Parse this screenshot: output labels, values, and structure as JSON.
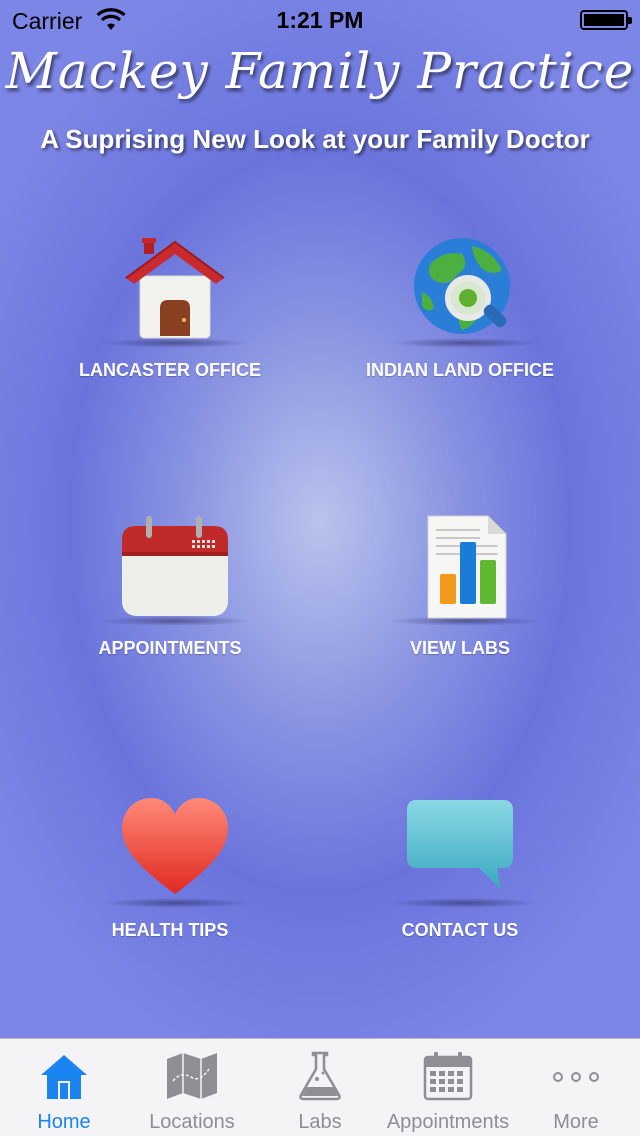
{
  "status_bar": {
    "carrier": "Carrier",
    "time": "1:21 PM"
  },
  "header": {
    "title": "Mackey Family Practice",
    "subtitle": "A Suprising New Look at your Family Doctor"
  },
  "tiles": [
    {
      "label": "LANCASTER OFFICE",
      "icon": "house-icon"
    },
    {
      "label": "INDIAN LAND OFFICE",
      "icon": "globe-search-icon"
    },
    {
      "label": "APPOINTMENTS",
      "icon": "calendar-icon"
    },
    {
      "label": "VIEW LABS",
      "icon": "document-chart-icon"
    },
    {
      "label": "HEALTH TIPS",
      "icon": "heart-icon"
    },
    {
      "label": "CONTACT US",
      "icon": "speech-bubble-icon"
    }
  ],
  "tab_bar": {
    "active": "Home",
    "tabs": [
      {
        "label": "Home",
        "icon": "home-icon"
      },
      {
        "label": "Locations",
        "icon": "map-icon"
      },
      {
        "label": "Labs",
        "icon": "flask-icon"
      },
      {
        "label": "Appointments",
        "icon": "calendar-icon"
      },
      {
        "label": "More",
        "icon": "more-dots-icon"
      }
    ]
  },
  "colors": {
    "tab_active": "#1a84f0",
    "tab_inactive": "#8e8e93",
    "background": "#6a74dc"
  }
}
